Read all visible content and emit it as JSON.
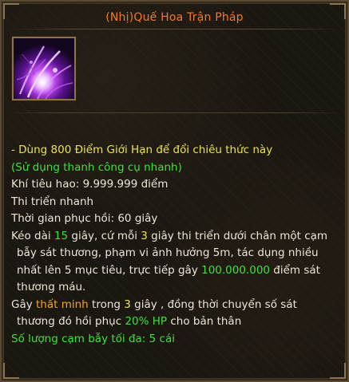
{
  "tooltip": {
    "title": "(Nhị)Quế Hoa Trận Pháp",
    "icon": "purple-magic-burst-icon",
    "colors": {
      "title": "#f07a28",
      "highlight_yellow": "#e8e44a",
      "highlight_green": "#3ee03a",
      "highlight_orange": "#f2a526",
      "text": "#ece6d6"
    },
    "lines": {
      "l1": "- Dùng 800 Điểm Giới Hạn để đổi chiêu thức này",
      "l2": "(Sử dụng thanh công cụ nhanh)",
      "l3": "Khí tiêu hao: 9.999.999 điểm",
      "l4": "Thi triển nhanh",
      "l5": "Thời gian phục hồi: 60 giây",
      "l6_a": "Kéo dài ",
      "l6_b": "15",
      "l6_c": " giây, cứ mỗi ",
      "l6_d": "3",
      "l6_e": " giây thi triển dưới chân một cạm",
      "l7": "bẫy sát thương, phạm vi ảnh hưởng 5m, tác dụng nhiều",
      "l8_a": "nhất lên 5 mục tiêu, trực tiếp gây ",
      "l8_b": "100.000.000",
      "l8_c": " điểm sát",
      "l9": "thương máu.",
      "l10_a": "Gây ",
      "l10_b": "thất minh",
      "l10_c": " trong ",
      "l10_d": "3",
      "l10_e": " giây , đồng thời chuyển số sát",
      "l11_a": "thương đó hồi phục ",
      "l11_b": "20% HP",
      "l11_c": " cho bản thân",
      "l12": "Số lượng cạm bẫy tối đa: 5 cái"
    }
  }
}
